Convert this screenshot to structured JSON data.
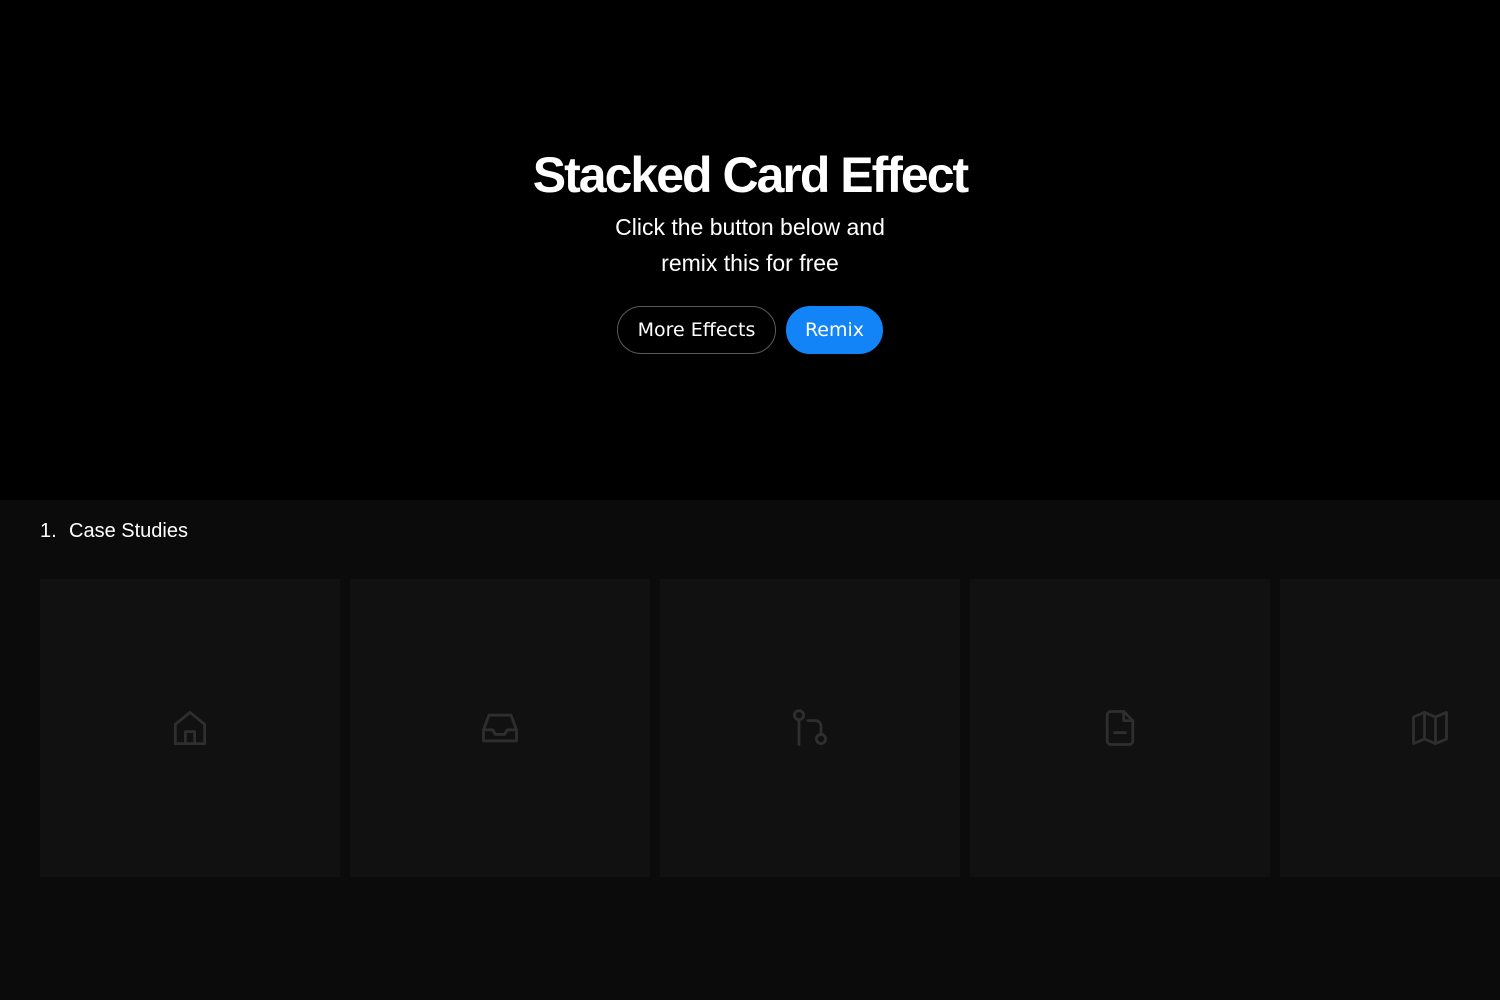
{
  "hero": {
    "title": "Stacked Card Effect",
    "subtitle_line1": "Click the button below and",
    "subtitle_line2": "remix this for free",
    "buttons": {
      "more_effects": "More Effects",
      "remix": "Remix"
    }
  },
  "section": {
    "number": "1.",
    "title": "Case Studies"
  },
  "cards": [
    {
      "icon": "home-icon"
    },
    {
      "icon": "inbox-icon"
    },
    {
      "icon": "git-pull-request-icon"
    },
    {
      "icon": "file-minus-icon"
    },
    {
      "icon": "map-icon"
    }
  ],
  "colors": {
    "background": "#000000",
    "section_background": "#0b0b0b",
    "card_background": "#111111",
    "accent": "#1284f7",
    "icon_stroke": "#2f2f2f"
  }
}
